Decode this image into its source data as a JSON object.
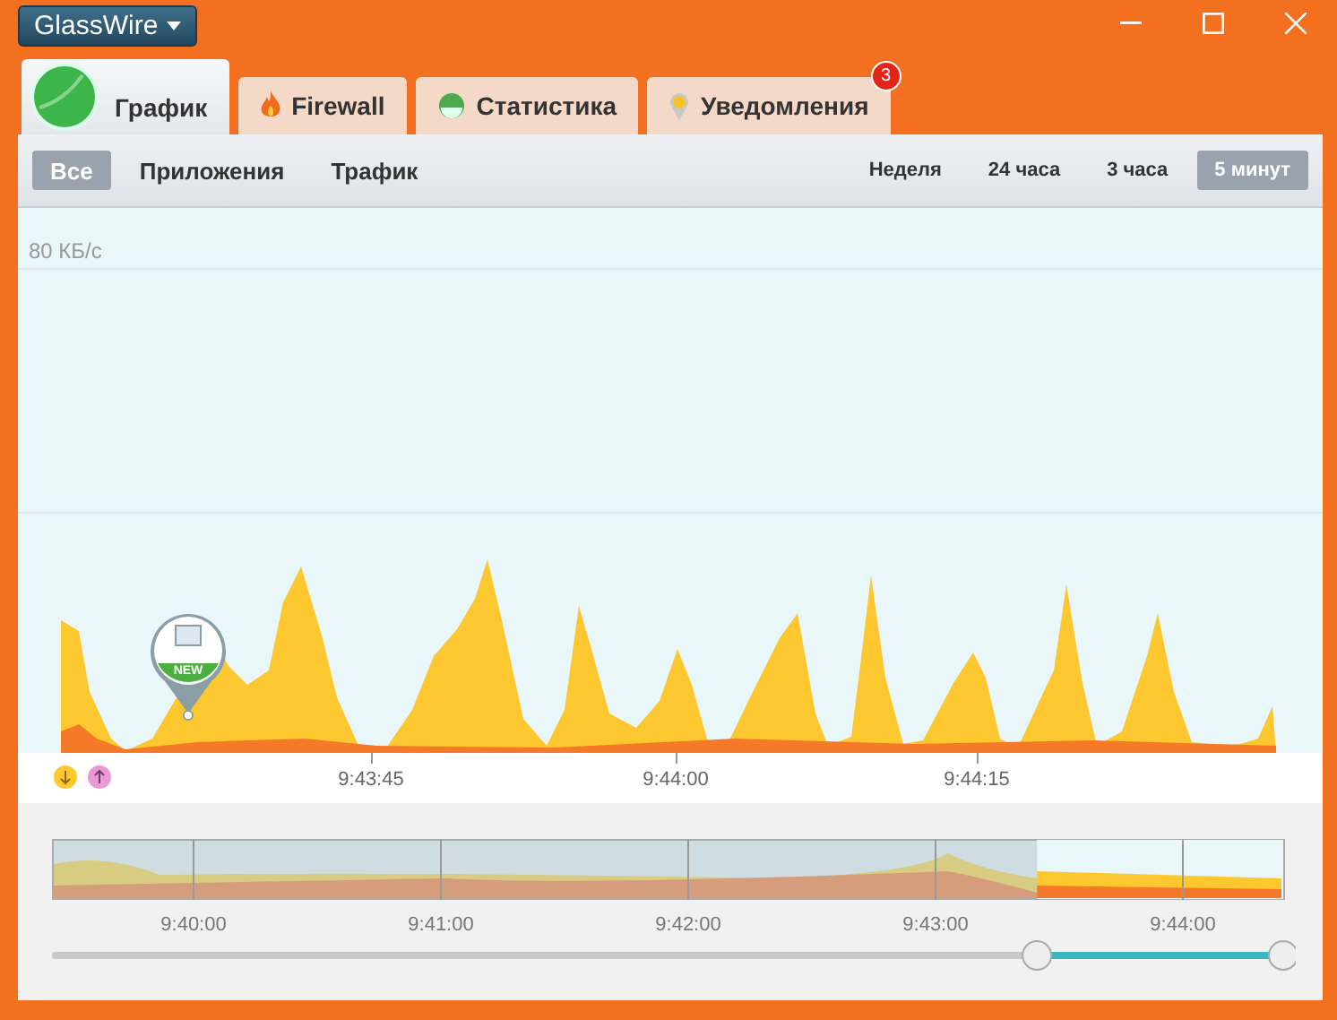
{
  "app_menu": {
    "label": "GlassWire"
  },
  "tabs": [
    {
      "label": "График",
      "kind": "graph",
      "selected": true
    },
    {
      "label": "Firewall",
      "kind": "firewall",
      "selected": false
    },
    {
      "label": "Статистика",
      "kind": "stats",
      "selected": false
    },
    {
      "label": "Уведомления",
      "kind": "alerts",
      "selected": false,
      "badge": "3"
    }
  ],
  "filters": [
    {
      "label": "Все",
      "selected": true
    },
    {
      "label": "Приложения",
      "selected": false
    },
    {
      "label": "Трафик",
      "selected": false
    }
  ],
  "ranges": [
    {
      "label": "Неделя",
      "selected": false
    },
    {
      "label": "24 часа",
      "selected": false
    },
    {
      "label": "3 часа",
      "selected": false
    },
    {
      "label": "5 минут",
      "selected": true
    }
  ],
  "graph": {
    "y_label": "80 КБ/с",
    "marker": {
      "label": "NEW"
    },
    "time_ticks": [
      "9:43:45",
      "9:44:00",
      "9:44:15"
    ]
  },
  "overview": {
    "time_ticks": [
      "9:40:00",
      "9:41:00",
      "9:42:00",
      "9:43:00",
      "9:44:00"
    ],
    "selection": {
      "level": 0.2
    }
  }
}
